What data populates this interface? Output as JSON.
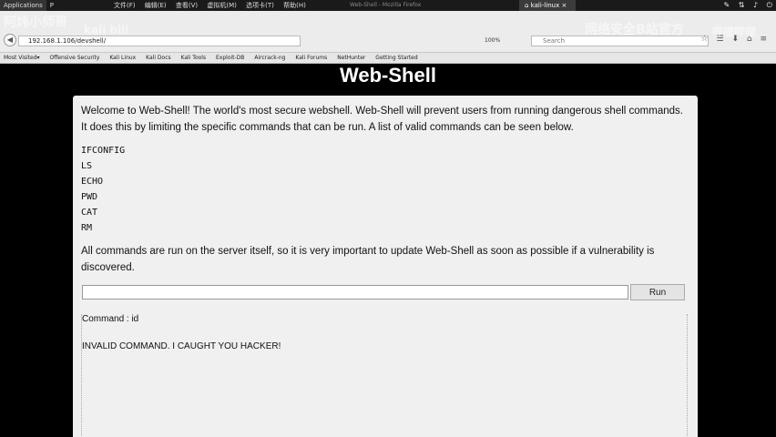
{
  "topbar": {
    "applications": "Applications",
    "places": "P",
    "menus": [
      "文件(F)",
      "编辑(E)",
      "查看(V)",
      "虚拟机(M)",
      "选项卡(T)",
      "帮助(H)"
    ],
    "window_title": "Web-Shell - Mozilla Firefox",
    "tab_label": "kali-linux"
  },
  "watermark": {
    "left": "阿炜小师哥",
    "left2": "kali bili",
    "right": "网络安全B站官方",
    "right2": "哔哩哔哩"
  },
  "browser": {
    "url": "192.168.1.106/devshell/",
    "zoom": "100%",
    "search_placeholder": "Search"
  },
  "bookmarks": [
    "Most Visited▾",
    "Offensive Security",
    "Kali Linux",
    "Kali Docs",
    "Kali Tools",
    "Exploit-DB",
    "Aircrack-ng",
    "Kali Forums",
    "NetHunter",
    "Getting Started"
  ],
  "page": {
    "title": "Web-Shell",
    "intro": "Welcome to Web-Shell! The world's most secure webshell. Web-Shell will prevent users from running dangerous shell commands. It does this by limiting the specific commands that can be run. A list of valid commands can be seen below.",
    "commands": [
      "IFCONFIG",
      "LS",
      "ECHO",
      "PWD",
      "CAT",
      "RM"
    ],
    "note": "All commands are run on the server itself, so it is very important to update Web-Shell as soon as possible if a vulnerability is discovered.",
    "input_value": "",
    "run_label": "Run",
    "output_command": "Command : id",
    "output_result": "INVALID COMMAND. I CAUGHT YOU HACKER!"
  }
}
